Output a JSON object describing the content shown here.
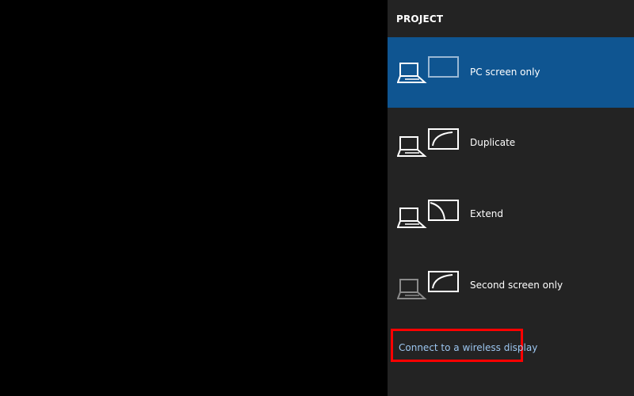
{
  "panel": {
    "title": "PROJECT",
    "options": [
      {
        "label": "PC screen only",
        "selected": true,
        "icon": "pc-screen-only-icon"
      },
      {
        "label": "Duplicate",
        "selected": false,
        "icon": "duplicate-icon"
      },
      {
        "label": "Extend",
        "selected": false,
        "icon": "extend-icon"
      },
      {
        "label": "Second screen only",
        "selected": false,
        "icon": "second-screen-only-icon"
      }
    ],
    "wireless_link": "Connect to a wireless display"
  },
  "colors": {
    "panel_bg": "#232323",
    "selected_bg": "#0f5591",
    "link": "#9cc6f0",
    "highlight_border": "#ff0000"
  }
}
